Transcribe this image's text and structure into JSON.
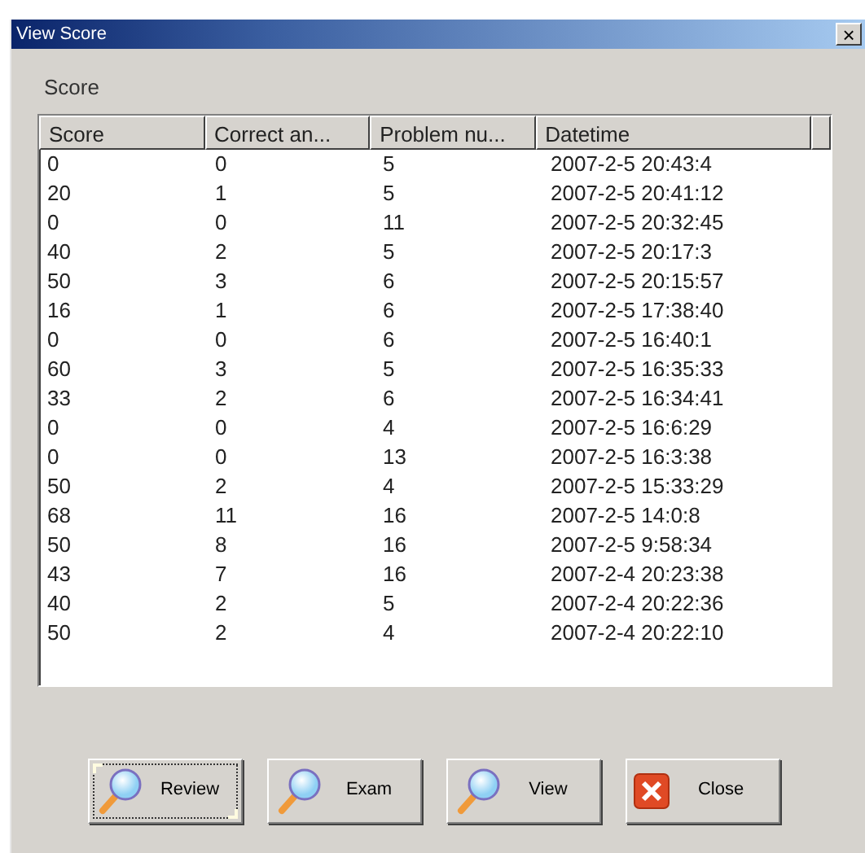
{
  "window": {
    "title": "View Score",
    "close_glyph": "×"
  },
  "group_label": "Score",
  "table": {
    "columns": [
      "Score",
      "Correct an...",
      "Problem nu...",
      "Datetime"
    ],
    "rows": [
      [
        "0",
        "0",
        "5",
        "2007-2-5 20:43:4"
      ],
      [
        "20",
        "1",
        "5",
        "2007-2-5 20:41:12"
      ],
      [
        "0",
        "0",
        "11",
        "2007-2-5 20:32:45"
      ],
      [
        "40",
        "2",
        "5",
        "2007-2-5 20:17:3"
      ],
      [
        "50",
        "3",
        "6",
        "2007-2-5 20:15:57"
      ],
      [
        "16",
        "1",
        "6",
        "2007-2-5 17:38:40"
      ],
      [
        "0",
        "0",
        "6",
        "2007-2-5 16:40:1"
      ],
      [
        "60",
        "3",
        "5",
        "2007-2-5 16:35:33"
      ],
      [
        "33",
        "2",
        "6",
        "2007-2-5 16:34:41"
      ],
      [
        "0",
        "0",
        "4",
        "2007-2-5 16:6:29"
      ],
      [
        "0",
        "0",
        "13",
        "2007-2-5 16:3:38"
      ],
      [
        "50",
        "2",
        "4",
        "2007-2-5 15:33:29"
      ],
      [
        "68",
        "11",
        "16",
        "2007-2-5 14:0:8"
      ],
      [
        "50",
        "8",
        "16",
        "2007-2-5 9:58:34"
      ],
      [
        "43",
        "7",
        "16",
        "2007-2-4 20:23:38"
      ],
      [
        "40",
        "2",
        "5",
        "2007-2-4 20:22:36"
      ],
      [
        "50",
        "2",
        "4",
        "2007-2-4 20:22:10"
      ]
    ]
  },
  "buttons": [
    {
      "label": "Review",
      "kind": "search",
      "focused": true
    },
    {
      "label": "Exam",
      "kind": "search",
      "focused": false
    },
    {
      "label": "View",
      "kind": "search",
      "focused": false
    },
    {
      "label": "Close",
      "kind": "close",
      "focused": false
    }
  ]
}
